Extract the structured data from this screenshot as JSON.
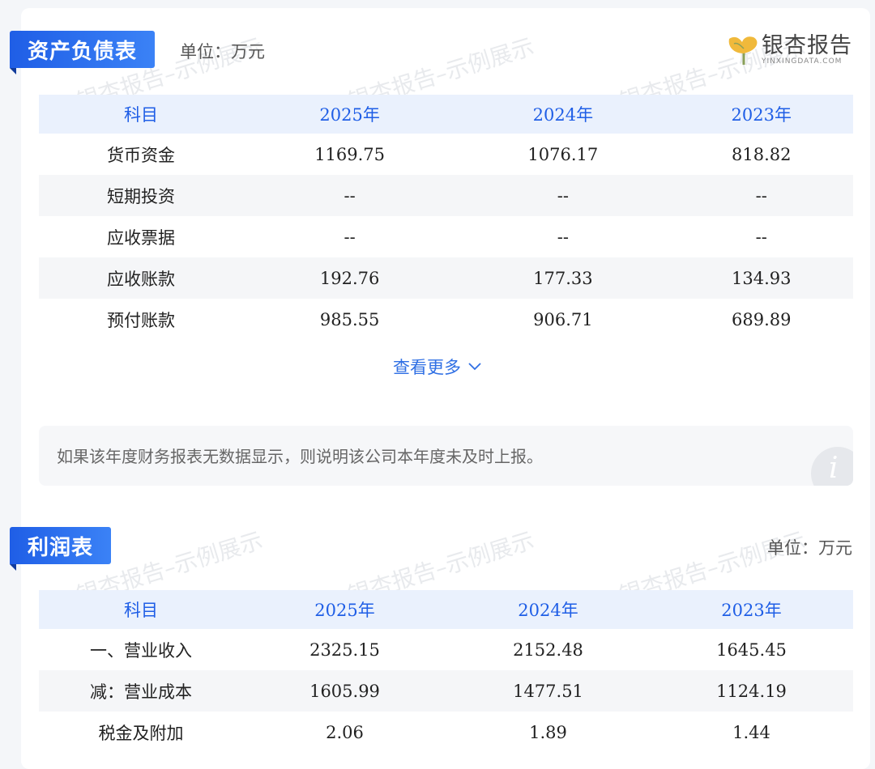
{
  "watermark_text": "银杏报告–示例展示",
  "logo": {
    "text": "银杏报告",
    "sub": "YINXINGDATA.COM"
  },
  "balance_sheet": {
    "title": "资产负债表",
    "unit": "单位：万元",
    "headers": [
      "科目",
      "2025年",
      "2024年",
      "2023年"
    ],
    "rows": [
      {
        "label": "货币资金",
        "v2025": "1169.75",
        "v2024": "1076.17",
        "v2023": "818.82"
      },
      {
        "label": "短期投资",
        "v2025": "--",
        "v2024": "--",
        "v2023": "--"
      },
      {
        "label": "应收票据",
        "v2025": "--",
        "v2024": "--",
        "v2023": "--"
      },
      {
        "label": "应收账款",
        "v2025": "192.76",
        "v2024": "177.33",
        "v2023": "134.93"
      },
      {
        "label": "预付账款",
        "v2025": "985.55",
        "v2024": "906.71",
        "v2023": "689.89"
      }
    ],
    "more_label": "查看更多",
    "note": "如果该年度财务报表无数据显示，则说明该公司本年度未及时上报。"
  },
  "income_statement": {
    "title": "利润表",
    "unit": "单位：万元",
    "headers": [
      "科目",
      "2025年",
      "2024年",
      "2023年"
    ],
    "rows": [
      {
        "label": "一、营业收入",
        "v2025": "2325.15",
        "v2024": "2152.48",
        "v2023": "1645.45"
      },
      {
        "label": "减：营业成本",
        "v2025": "1605.99",
        "v2024": "1477.51",
        "v2023": "1124.19"
      },
      {
        "label": "税金及附加",
        "v2025": "2.06",
        "v2024": "1.89",
        "v2023": "1.44"
      }
    ]
  },
  "colors": {
    "accent": "#1f5ee6",
    "header_bg": "#eaf1fd",
    "stripe": "#f5f6f8"
  }
}
